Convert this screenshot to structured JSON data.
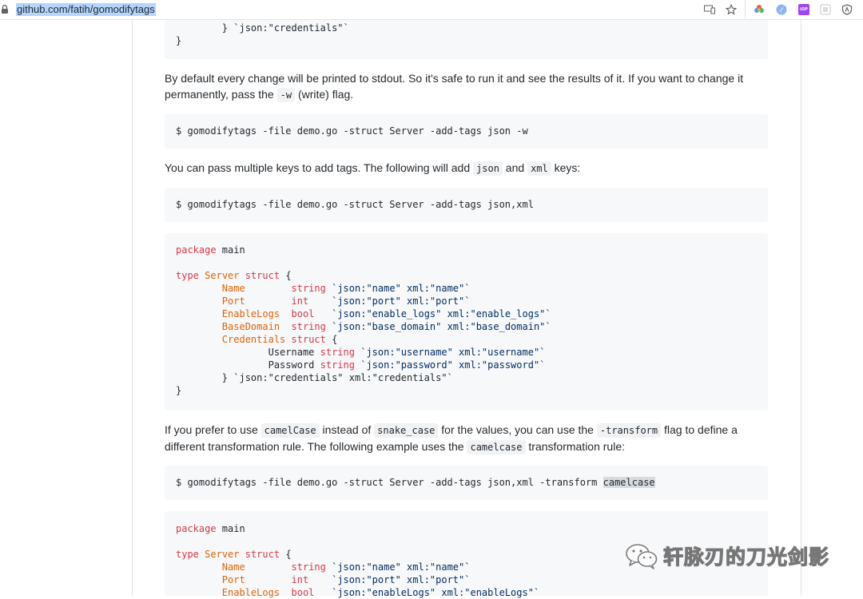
{
  "browser": {
    "url": "github.com/fatih/gomodifytags",
    "icons": [
      "lock-icon",
      "devices-icon",
      "star-icon",
      "colorwheel-icon",
      "compass-icon",
      "iop-icon",
      "puzzle-icon",
      "shield-icon"
    ],
    "iop_label": "IOP"
  },
  "block1": {
    "lines": [
      "        } `json:\"credentials\"`",
      "}"
    ]
  },
  "p1": {
    "text_a": "By default every change will be printed to stdout. So it's safe to run it and see the results of it. If you want to change it permanently, pass the ",
    "code": "-w",
    "text_b": " (write) flag."
  },
  "cmd1": "$ gomodifytags -file demo.go -struct Server -add-tags json -w",
  "p2": {
    "text_a": "You can pass multiple keys to add tags. The following will add ",
    "code_a": "json",
    "text_b": " and ",
    "code_b": "xml",
    "text_c": " keys:"
  },
  "cmd2": "$ gomodifytags -file demo.go -struct Server -add-tags json,xml",
  "block2": {
    "pkg_kw": "package",
    "pkg_name": " main",
    "type_kw": "type",
    "type_name": "Server",
    "struct_kw": "struct",
    "brace_open": " {",
    "fields": [
      {
        "name": "Name",
        "type": "string",
        "tag": "`json:\"name\" xml:\"name\"`"
      },
      {
        "name": "Port",
        "type": "int",
        "tag": "`json:\"port\" xml:\"port\"`"
      },
      {
        "name": "EnableLogs",
        "type": "bool",
        "tag": "`json:\"enable_logs\" xml:\"enable_logs\"`"
      },
      {
        "name": "BaseDomain",
        "type": "string",
        "tag": "`json:\"base_domain\" xml:\"base_domain\"`"
      }
    ],
    "cred_name": "Credentials",
    "cred_struct": "struct",
    "sub_fields": [
      {
        "name": "Username",
        "type": "string",
        "tag": "`json:\"username\" xml:\"username\"`"
      },
      {
        "name": "Password",
        "type": "string",
        "tag": "`json:\"password\" xml:\"password\"`"
      }
    ],
    "cred_close": "} `json:\"credentials\" xml:\"credentials\"`",
    "close": "}"
  },
  "p3": {
    "text_a": "If you prefer to use ",
    "code_a": "camelCase",
    "text_b": " instead of ",
    "code_b": "snake_case",
    "text_c": " for the values, you can use the ",
    "code_c": "-transform",
    "text_d": " flag to define a different transformation rule. The following example uses the ",
    "code_d": "camelcase",
    "text_e": " transformation rule:"
  },
  "cmd3": {
    "prefix": "$ gomodifytags -file demo.go -struct Server -add-tags json,xml -transform ",
    "highlight": "camelcase"
  },
  "block3": {
    "pkg_kw": "package",
    "pkg_name": " main",
    "type_kw": "type",
    "type_name": "Server",
    "struct_kw": "struct",
    "brace_open": " {",
    "fields": [
      {
        "name": "Name",
        "type": "string",
        "tag": "`json:\"name\" xml:\"name\"`"
      },
      {
        "name": "Port",
        "type": "int",
        "tag": "`json:\"port\" xml:\"port\"`"
      },
      {
        "name": "EnableLogs",
        "type": "bool",
        "tag": "`json:\"enableLogs\" xml:\"enableLogs\"`"
      }
    ]
  },
  "watermark": {
    "text": "轩脉刃的刀光剑影",
    "icon": "wechat-icon"
  }
}
